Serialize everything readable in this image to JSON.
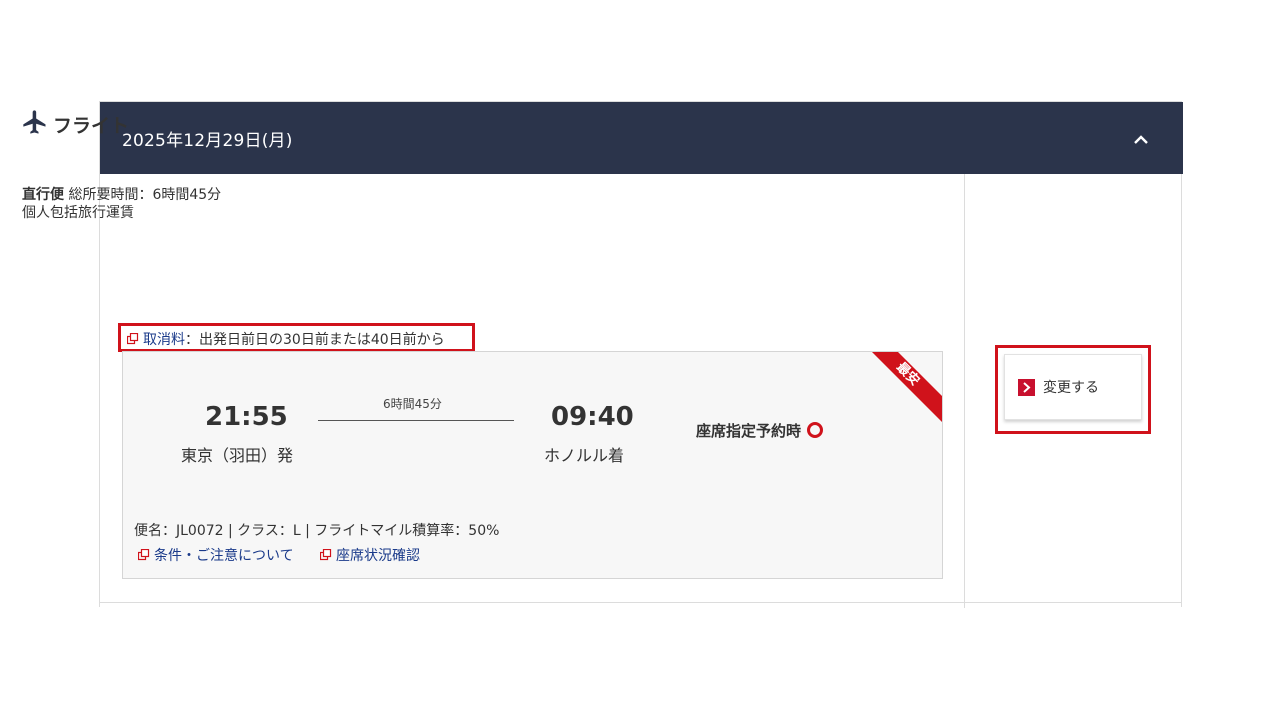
{
  "header": {
    "date": "2025年12月29日(月)"
  },
  "section": {
    "title": "フライト"
  },
  "itinerary": {
    "direct_label": "直行便",
    "total_duration": "総所要時間：6時間45分",
    "fare_type": "個人包括旅行運賃",
    "cancel_link": "取消料",
    "cancel_text": "：出発日前日の30日前または40日前から"
  },
  "flight": {
    "badge": "最安",
    "departure_time": "21:55",
    "departure_city": "東京（羽田）発",
    "duration": "6時間45分",
    "arrival_time": "09:40",
    "arrival_city": "ホノルル着",
    "seat_reservation_label": "座席指定予約時",
    "details": "便名：JL0072 |  クラス：L |  フライトマイル積算率：50%",
    "links": [
      "条件・ご注意について",
      "座席状況確認"
    ]
  },
  "actions": {
    "change_label": "変更する"
  },
  "colors": {
    "header_bg": "#2b344b",
    "accent_red": "#d0121b",
    "link_blue": "#1a3a8a"
  }
}
